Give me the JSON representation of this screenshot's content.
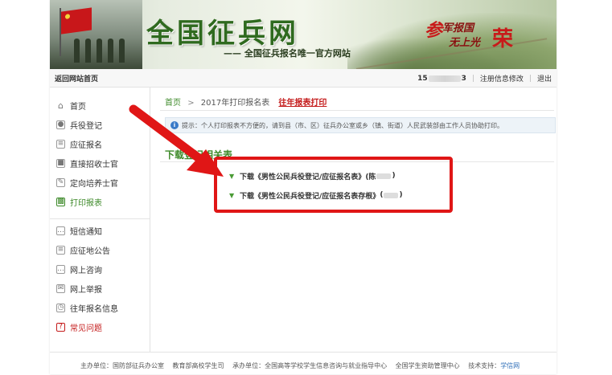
{
  "banner": {
    "title": "全国征兵网",
    "subtitle": "—— 全国征兵报名唯一官方网站",
    "slogan_1": "参",
    "slogan_2": "军报国",
    "slogan_3": "无上光",
    "slogan_4": "荣"
  },
  "topnav": {
    "home_link": "返回网站首页",
    "user_prefix": "15",
    "user_suffix": "3",
    "edit_info": "注册信息修改",
    "logout": "退出"
  },
  "sidebar": {
    "items": [
      {
        "label": "首页",
        "icon": "home-icon"
      },
      {
        "label": "兵役登记",
        "icon": "id-card-icon"
      },
      {
        "label": "应征报名",
        "icon": "form-icon"
      },
      {
        "label": "直接招收士官",
        "icon": "document-icon"
      },
      {
        "label": "定向培养士官",
        "icon": "edit-icon"
      },
      {
        "label": "打印报表",
        "icon": "printer-icon"
      },
      {
        "label": "短信通知",
        "icon": "message-icon"
      },
      {
        "label": "应征地公告",
        "icon": "notice-icon"
      },
      {
        "label": "网上咨询",
        "icon": "chat-icon"
      },
      {
        "label": "网上举报",
        "icon": "mail-icon"
      },
      {
        "label": "往年报名信息",
        "icon": "history-icon"
      },
      {
        "label": "常见问题",
        "icon": "question-icon"
      }
    ],
    "active": "打印报表"
  },
  "breadcrumb": {
    "home": "首页",
    "separator": ">",
    "current": "2017年打印报名表",
    "history_link": "往年报表打印"
  },
  "notice": {
    "label": "提示",
    "text": "：个人打印报表不方便的，请到县（市、区）征兵办公室或乡（镇、街道）人民武装部由工作人员协助打印。"
  },
  "section": {
    "title": "下载登记相关表"
  },
  "downloads": [
    {
      "prefix": "下载",
      "name": "《男性公民兵役登记/应征报名表》",
      "suffix_open": "(陈",
      "suffix_close": ")"
    },
    {
      "prefix": "下载",
      "name": "《男性公民兵役登记/应征报名表存根》",
      "suffix_open": "(",
      "suffix_close": ")"
    }
  ],
  "footer": {
    "host": "主办单位：国防部征兵办公室",
    "co_host": "教育部高校学生司",
    "organizer": "承办单位：全国高等学校学生信息咨询与就业指导中心",
    "aid_center": "全国学生资助管理中心",
    "tech_label": "技术支持：",
    "tech_support": "学信网"
  },
  "colors": {
    "accent_green": "#3e8a2a",
    "highlight_red": "#e01616",
    "banner_title": "#2f6a1f"
  }
}
